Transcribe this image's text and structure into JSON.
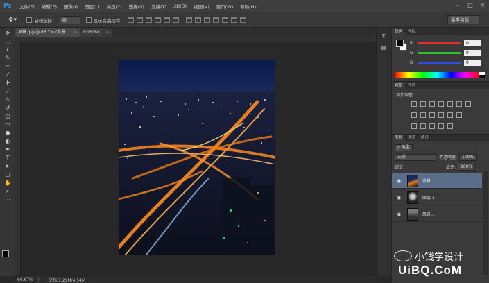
{
  "app": {
    "logo": "Ps"
  },
  "menu": [
    "文件(F)",
    "编辑(E)",
    "图像(I)",
    "图层(L)",
    "类型(Y)",
    "选择(S)",
    "滤镜(T)",
    "3D(D)",
    "视图(V)",
    "窗口(W)",
    "帮助(H)"
  ],
  "window_controls": {
    "minimize": "–",
    "maximize": "□",
    "close": "×"
  },
  "options": {
    "auto_select_label": "自动选择：",
    "auto_select_value": "组",
    "show_transform_label": "显示变换控件",
    "workspace": "基本功能"
  },
  "tabs": [
    {
      "label": "风景.jpg @ 66.7% (背景...",
      "close": "×",
      "active": true
    },
    {
      "label": "RGB/8#)",
      "close": "×",
      "active": false
    }
  ],
  "status": {
    "zoom": "66.67%",
    "doc": "文档:1.29M/4.54M"
  },
  "panels": {
    "color_tabs": [
      "颜色",
      "色板"
    ],
    "color_sliders": [
      {
        "label": "R",
        "value": "0",
        "color": "#e03030"
      },
      {
        "label": "G",
        "value": "0",
        "color": "#30c030"
      },
      {
        "label": "B",
        "value": "0",
        "color": "#3050e0"
      }
    ],
    "adjust_tabs": [
      "调整",
      "样式"
    ],
    "adjust_title": "添加调整",
    "layers_tabs": [
      "图层",
      "通道",
      "路径"
    ],
    "filter_type": "ρ 类型",
    "blend_mode": "正常",
    "opacity_label": "不透明度:",
    "opacity_value": "100%",
    "lock_label": "锁定:",
    "fill_label": "填充:",
    "fill_value": "100%",
    "layers": [
      {
        "name": "背景...",
        "selected": true
      },
      {
        "name": "图层 1",
        "selected": false
      },
      {
        "name": "风景...",
        "selected": false
      }
    ]
  },
  "watermark": {
    "name": "小钱学设计",
    "site": "UiBQ.CoM"
  }
}
